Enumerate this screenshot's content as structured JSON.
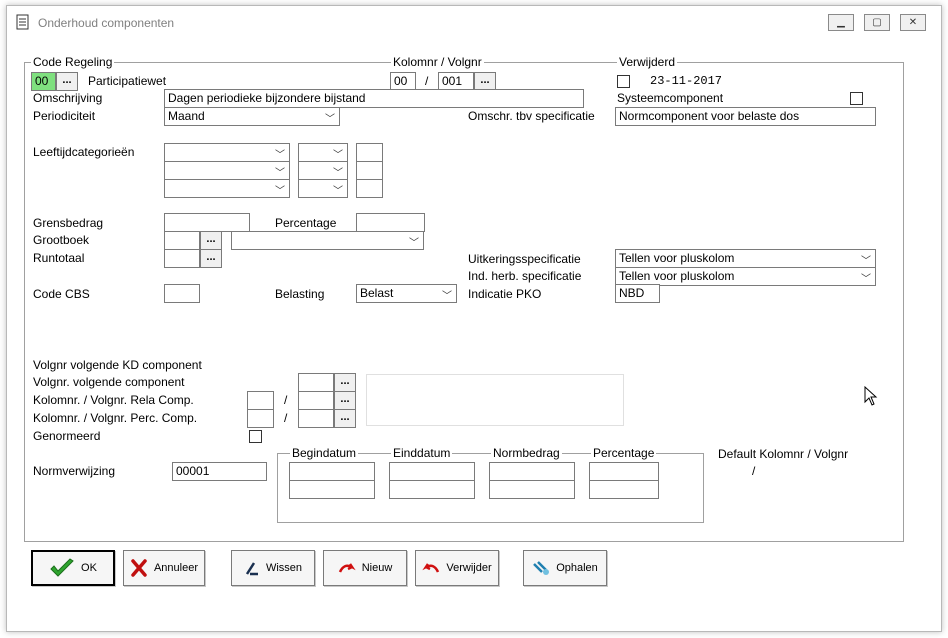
{
  "window": {
    "title": "Onderhoud componenten"
  },
  "regeling": {
    "label": "Code Regeling",
    "code": "00",
    "name": "Participatiewet"
  },
  "kolomnr": {
    "label": "Kolomnr / Volgnr",
    "kolom": "00",
    "sep": "/",
    "volgnr": "001"
  },
  "verwijderd": {
    "label": "Verwijderd",
    "date": "23-11-2017"
  },
  "omschrijving": {
    "label": "Omschrijving",
    "value": "Dagen periodieke bijzondere bijstand"
  },
  "systeemcomponent": {
    "label": "Systeemcomponent"
  },
  "periodiciteit": {
    "label": "Periodiciteit",
    "value": "Maand"
  },
  "omschr_spec": {
    "label": "Omschr. tbv specificatie",
    "value": "Normcomponent voor belaste dos"
  },
  "leeftijd": {
    "label": "Leeftijdcategorieën"
  },
  "grensbedrag": {
    "label": "Grensbedrag"
  },
  "percentage": {
    "label": "Percentage"
  },
  "grootboek": {
    "label": "Grootboek"
  },
  "runtotaal": {
    "label": "Runtotaal"
  },
  "uitkering_spec": {
    "label": "Uitkeringsspecificatie",
    "value": "Tellen voor pluskolom"
  },
  "ind_herb": {
    "label": "Ind. herb. specificatie",
    "value": "Tellen voor pluskolom"
  },
  "code_cbs": {
    "label": "Code CBS"
  },
  "belasting": {
    "label": "Belasting",
    "value": "Belast"
  },
  "pko": {
    "label": "Indicatie PKO",
    "value": "NBD"
  },
  "volgende": {
    "kd_label": "Volgnr volgende KD component",
    "comp_label": "Volgnr. volgende component",
    "rela_label": "Kolomnr. / Volgnr. Rela Comp.",
    "perc_label": "Kolomnr. / Volgnr. Perc. Comp.",
    "genormeerd_label": "Genormeerd",
    "sep": "/"
  },
  "normverwijzing": {
    "label": "Normverwijzing",
    "value": "00001"
  },
  "normgroup": {
    "begindatum": "Begindatum",
    "einddatum": "Einddatum",
    "normbedrag": "Normbedrag",
    "percentage": "Percentage"
  },
  "default_kolom": {
    "label": "Default Kolomnr / Volgnr",
    "sep": "/"
  },
  "buttons": {
    "ok": "OK",
    "annuleer": "Annuleer",
    "wissen": "Wissen",
    "nieuw": "Nieuw",
    "verwijder": "Verwijder",
    "ophalen": "Ophalen",
    "dots": "..."
  },
  "colors": {
    "code_highlight": "#7fe07f",
    "ok_check": "#2fa52f",
    "cancel_x": "#c01010",
    "red_arrow": "#d01010"
  }
}
